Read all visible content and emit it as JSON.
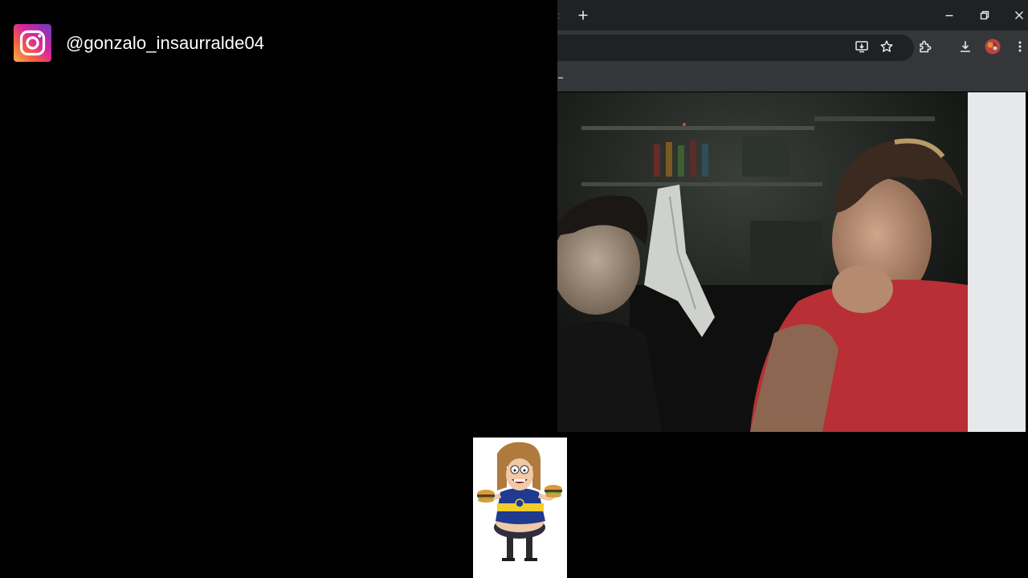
{
  "overlay": {
    "platform_icon": "instagram-icon",
    "handle": "@gonzalo_insaurralde04"
  },
  "browser": {
    "tab_separator": ":",
    "new_tab_icon": "plus-icon",
    "window_controls": [
      "minimize-icon",
      "restore-icon",
      "close-icon"
    ],
    "toolbar_icons": [
      "install-app-icon",
      "star-icon",
      "extensions-icon",
      "download-icon",
      "profile-avatar",
      "kebab-menu-icon"
    ],
    "bookmark_bar_marker": "–",
    "colors": {
      "titlebar": "#202124",
      "toolbar": "#35363a",
      "omnibox": "#202124",
      "icon": "#e8eaed",
      "side_panel": "#e7e8ea"
    }
  },
  "video": {
    "scene": "webcam-video-frame"
  },
  "sticker": {
    "name": "cartoon-character-sticker"
  }
}
